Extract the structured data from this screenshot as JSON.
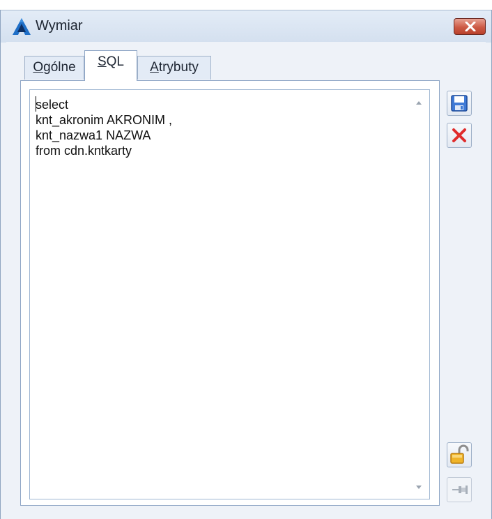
{
  "window": {
    "title": "Wymiar",
    "icons": {
      "app": "app-logo-icon",
      "close": "close-icon"
    }
  },
  "tabs": [
    {
      "label_prefix": "",
      "label_underlined": "O",
      "label_rest": "gólne",
      "active": false
    },
    {
      "label_prefix": "",
      "label_underlined": "S",
      "label_rest": "QL",
      "active": true
    },
    {
      "label_prefix": "",
      "label_underlined": "A",
      "label_rest": "trybuty",
      "active": false
    }
  ],
  "editor": {
    "sql": "select\nknt_akronim AKRONIM ,\nknt_nazwa1 NAZWA\nfrom cdn.kntkarty"
  },
  "toolbar": {
    "save_icon": "save-disk-icon",
    "cancel_icon": "cancel-x-icon",
    "lock_icon": "unlocked-padlock-icon",
    "pin_icon": "pin-icon"
  },
  "colors": {
    "accent": "#1f6fc7",
    "close_red": "#cd5b45",
    "cancel_red": "#e02b2b"
  }
}
